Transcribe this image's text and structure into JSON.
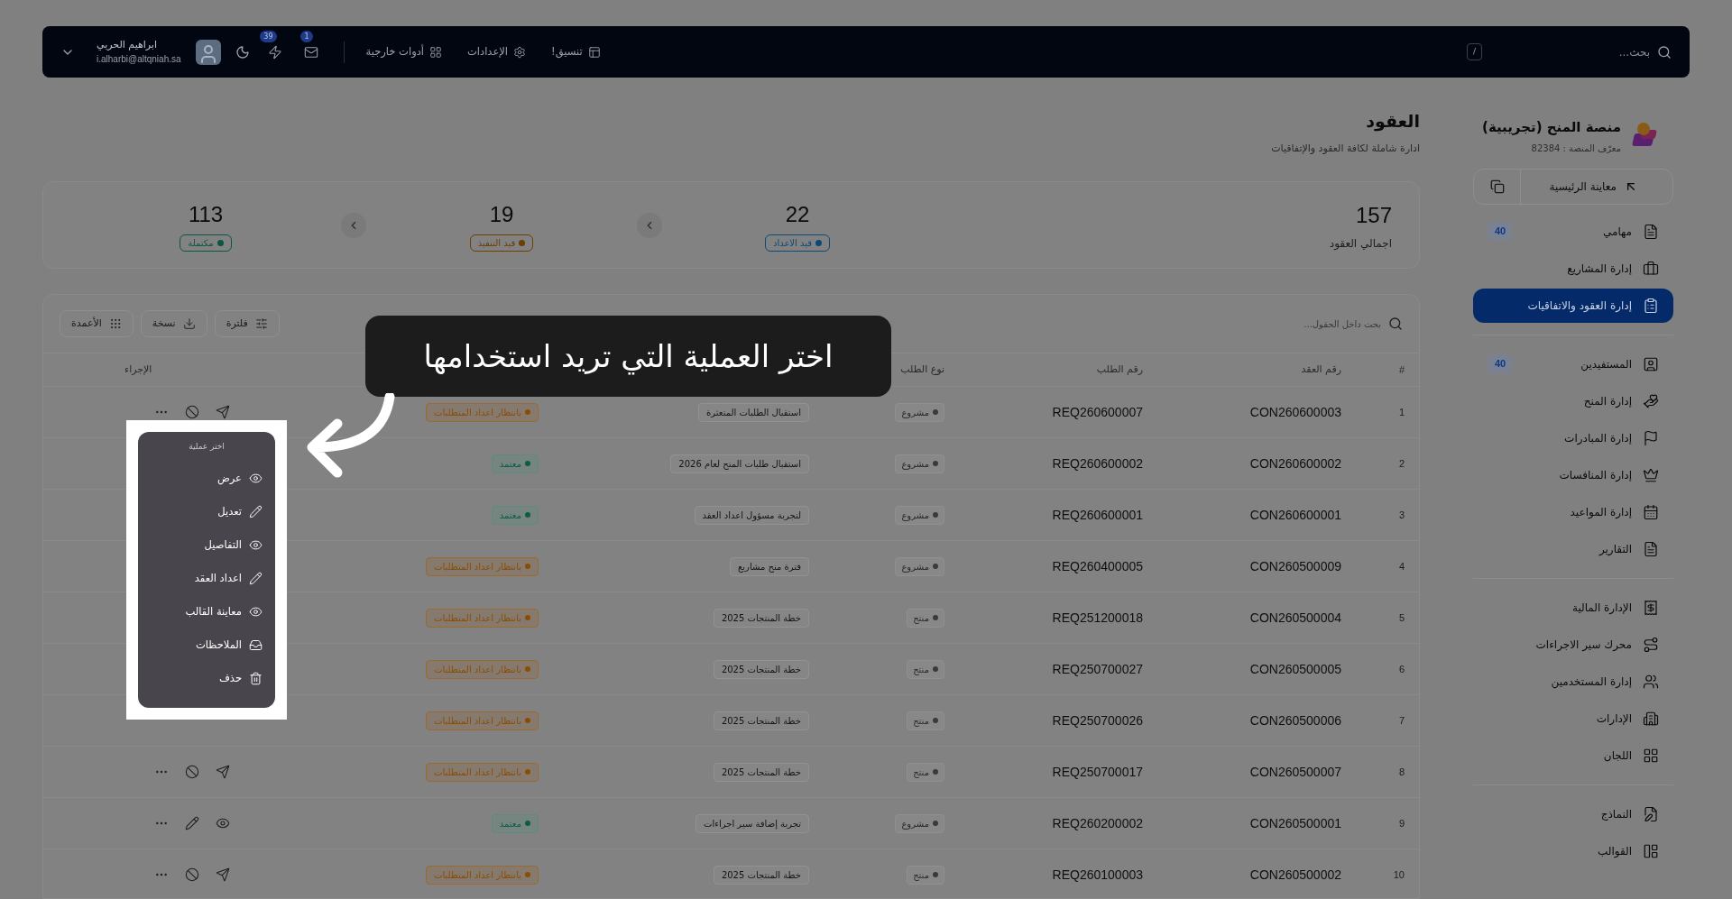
{
  "top_bar": {
    "search": {
      "placeholder": "بحث..."
    },
    "shortcut": "/",
    "nav": [
      {
        "kind": "layout",
        "label": "تنسيق!"
      },
      {
        "kind": "settings",
        "label": "الإعدادات"
      },
      {
        "kind": "tools",
        "label": "أدوات خارجية"
      }
    ],
    "notifications": [
      {
        "kind": "mail",
        "count": "1"
      },
      {
        "kind": "bolt",
        "count": "39"
      }
    ],
    "user": {
      "name": "ابراهيم الحربي",
      "email": "i.alharbi@altqniah.sa"
    }
  },
  "sidebar": {
    "platform": {
      "name": "منصة المنح (تجريبية)",
      "id_label": "معرّف المنصة : 82384"
    },
    "preview_button": "معاينة الرئيسية",
    "sections": [
      [
        {
          "label": "مهامي",
          "badge": "40",
          "selected": false
        },
        {
          "label": "إدارة المشاريع",
          "selected": false
        },
        {
          "label": "إدارة العقود والاتفاقيات",
          "selected": true
        }
      ],
      [
        {
          "label": "المستفيدين",
          "badge": "40",
          "selected": false
        },
        {
          "label": "إدارة المنح",
          "selected": false
        },
        {
          "label": "إدارة المبادرات",
          "selected": false
        },
        {
          "label": "إدارة المنافسات",
          "selected": false
        },
        {
          "label": "إدارة المواعيد",
          "selected": false
        },
        {
          "label": "التقارير",
          "selected": false
        }
      ],
      [
        {
          "label": "الإدارة المالية",
          "selected": false
        },
        {
          "label": "محرك سير الاجراءات",
          "selected": false
        },
        {
          "label": "إدارة المستخدمين",
          "selected": false
        },
        {
          "label": "الإدارات",
          "selected": false
        },
        {
          "label": "اللجان",
          "selected": false
        }
      ],
      [
        {
          "label": "النماذج",
          "selected": false
        },
        {
          "label": "القوالب",
          "selected": false
        }
      ]
    ]
  },
  "page": {
    "title": "العقود",
    "subtitle": "ادارة شاملة لكافة العقود والإتفاقيات"
  },
  "stats": [
    {
      "kind": "total",
      "value": "157",
      "label": "اجمالي العقود"
    },
    {
      "kind": "status",
      "value": "22",
      "label": "قيد الاعداد",
      "color": "#0a4a75"
    },
    {
      "kind": "status",
      "value": "19",
      "label": "قيد التنفيذ",
      "color": "#6e3d00"
    },
    {
      "kind": "status",
      "value": "113",
      "label": "مكتملة",
      "color": "#0a5544"
    }
  ],
  "toolbar": {
    "search": {
      "placeholder": "بحث داخل الحقول..."
    },
    "buttons": [
      {
        "kind": "filter",
        "label": "فلترة"
      },
      {
        "kind": "download",
        "label": "نسخة"
      },
      {
        "kind": "columns",
        "label": "الأعمدة"
      }
    ]
  },
  "table": {
    "columns": [
      {
        "label": "#"
      },
      {
        "label": "رقم العقد"
      },
      {
        "label": "رقم الطلب"
      },
      {
        "label": "نوع الطلب"
      },
      {
        "label": "الإجراء"
      }
    ],
    "rows": [
      {
        "index": "1",
        "contract": "CON260600003",
        "request": "REQ260600007",
        "type": "مشروع",
        "name": "استقبال الطلبات المتعثرة",
        "status": {
          "kind": "pending",
          "label": "بانتظار اعداد المتطلبات"
        },
        "actions": {
          "kind": "send"
        }
      },
      {
        "index": "2",
        "contract": "CON260600002",
        "request": "REQ260600002",
        "type": "مشروع",
        "name": "استقبال طلبات المنح لعام 2026",
        "status": {
          "kind": "approved",
          "label": "معتمد"
        }
      },
      {
        "index": "3",
        "contract": "CON260600001",
        "request": "REQ260600001",
        "type": "مشروع",
        "name": "لتجربة مسؤول اعداد العقد",
        "status": {
          "kind": "approved",
          "label": "معتمد"
        }
      },
      {
        "index": "4",
        "contract": "CON260500009",
        "request": "REQ260400005",
        "type": "مشروع",
        "name": "فترة منح مشاريع",
        "status": {
          "kind": "pending",
          "label": "بانتظار اعداد المتطلبات"
        }
      },
      {
        "index": "5",
        "contract": "CON260500004",
        "request": "REQ251200018",
        "type": "منتج",
        "name": "خطة المنتجات 2025",
        "status": {
          "kind": "pending",
          "label": "بانتظار اعداد المتطلبات"
        }
      },
      {
        "index": "6",
        "contract": "CON260500005",
        "request": "REQ250700027",
        "type": "منتج",
        "name": "خطة المنتجات 2025",
        "status": {
          "kind": "pending",
          "label": "بانتظار اعداد المتطلبات"
        }
      },
      {
        "index": "7",
        "contract": "CON260500006",
        "request": "REQ250700026",
        "type": "منتج",
        "name": "خطة المنتجات 2025",
        "status": {
          "kind": "pending",
          "label": "بانتظار اعداد المتطلبات"
        }
      },
      {
        "index": "8",
        "contract": "CON260500007",
        "request": "REQ250700017",
        "type": "منتج",
        "name": "خطة المنتجات 2025",
        "status": {
          "kind": "pending",
          "label": "بانتظار اعداد المتطلبات"
        },
        "actions": {
          "kind": "send"
        }
      },
      {
        "index": "9",
        "contract": "CON260500001",
        "request": "REQ260200002",
        "type": "مشروع",
        "name": "تجربة إضافة سير اجراءات",
        "status": {
          "kind": "approved",
          "label": "معتمد"
        },
        "actions": {
          "kind": "review"
        }
      },
      {
        "index": "10",
        "contract": "CON260500002",
        "request": "REQ260100003",
        "type": "منتج",
        "name": "خطة المنتجات 2025",
        "status": {
          "kind": "pending",
          "label": "بانتظار اعداد المتطلبات"
        },
        "actions": {
          "kind": "send"
        }
      }
    ]
  },
  "action_menu": {
    "title": "اختر عملية",
    "items": [
      {
        "kind": "view",
        "label": "عرض"
      },
      {
        "kind": "edit",
        "label": "تعديل"
      },
      {
        "kind": "view",
        "label": "التفاصيل"
      },
      {
        "kind": "edit",
        "label": "اعداد العقد"
      },
      {
        "kind": "view",
        "label": "معاينة القالب"
      },
      {
        "kind": "notes",
        "label": "الملاحظات"
      },
      {
        "kind": "delete",
        "label": "حذف"
      }
    ]
  },
  "tutorial": {
    "callout": "اختر العملية التي تريد استخدامها"
  }
}
